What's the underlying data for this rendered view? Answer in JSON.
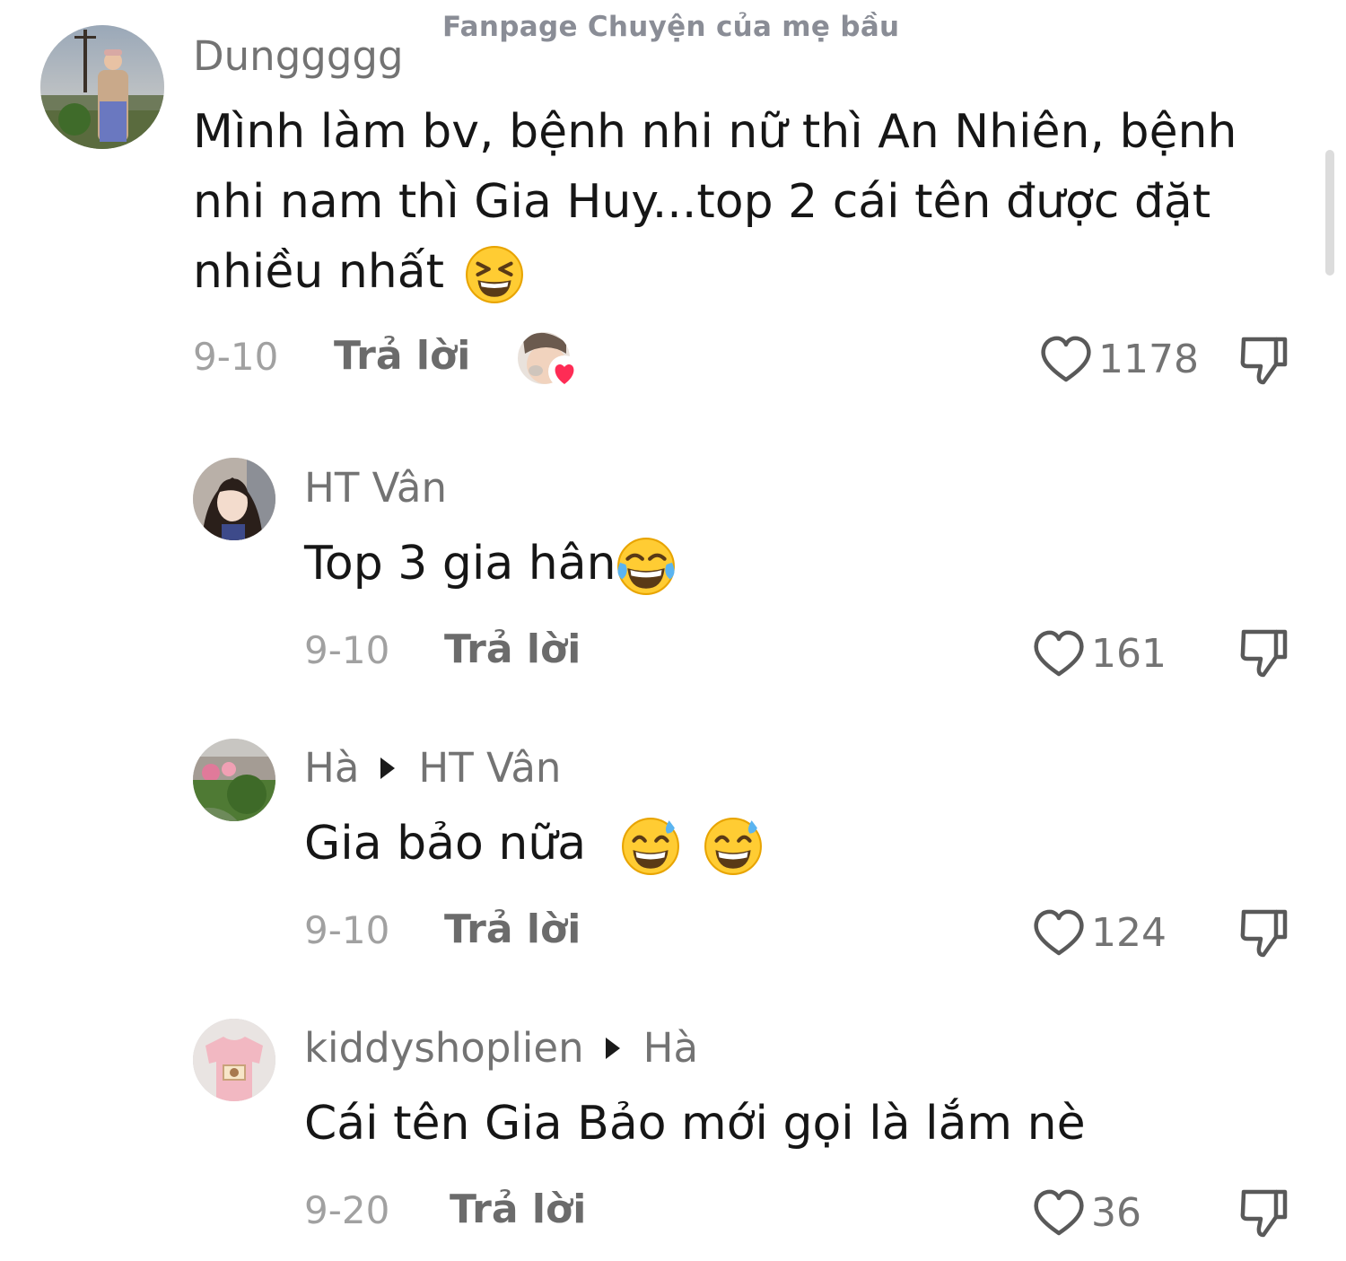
{
  "watermark": "Fanpage Chuyện của mẹ bầu",
  "comments": [
    {
      "username": "Dunggggg",
      "text": "Mình làm bv, bệnh nhi nữ thì An Nhiên, bệnh nhi nam thì Gia Huy...top 2 cái tên được đặt nhiều nhất",
      "emoji": "grinning-squinting-face",
      "date": "9-10",
      "reply_label": "Trả lời",
      "likes": "1178",
      "liked_by_creator": true
    },
    {
      "username": "HT Vân",
      "text": "Top 3 gia hân",
      "emoji": "face-with-tears-of-joy",
      "date": "9-10",
      "reply_label": "Trả lời",
      "likes": "161"
    },
    {
      "username": "Hà",
      "reply_to": "HT Vân",
      "text": "Gia bảo nữa",
      "emoji": "grinning-face-with-sweat",
      "date": "9-10",
      "reply_label": "Trả lời",
      "likes": "124"
    },
    {
      "username": "kiddyshoplien",
      "reply_to": "Hà",
      "text": "Cái tên Gia Bảo mới gọi là lắm nè",
      "date": "9-20",
      "reply_label": "Trả lời",
      "likes": "36"
    }
  ],
  "colors": {
    "text": "#161616",
    "username": "#737373",
    "date": "#a1a1a1",
    "heart_badge": "#fe2c55"
  }
}
